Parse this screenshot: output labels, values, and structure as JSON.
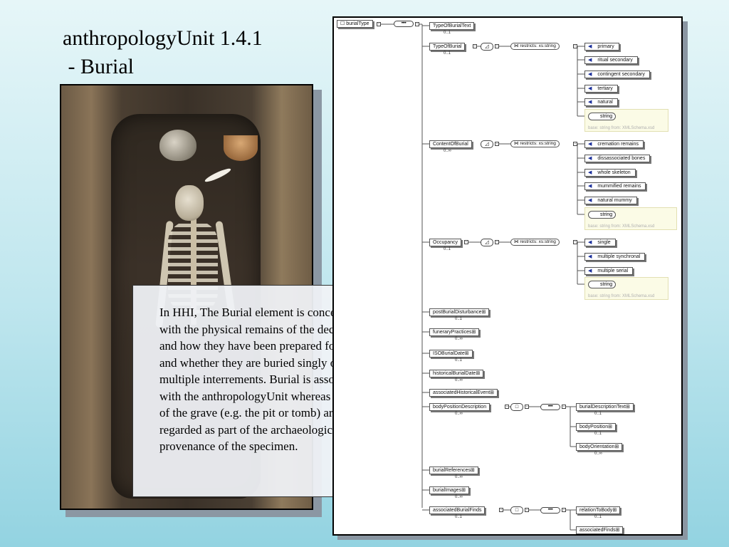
{
  "slide": {
    "title_line1": "anthropologyUnit 1.4.1",
    "title_line2": " - Burial",
    "description": "In HHI, The Burial element is concerned with the physical remains of the deceased and how they have been prepared for burial and whether they are buried singly or in multiple interrements. Burial is associated with the anthropologyUnit whereas details of the grave (e.g. the pit or tomb) are regarded as part of the archaeological provenance of the specimen."
  },
  "schema": {
    "root": "burialType",
    "seq_symbol": "••••",
    "elements": [
      {
        "name": "TypeOfBurialText",
        "occ": "0..1"
      },
      {
        "name": "TypeOfBurial",
        "occ": "0..1",
        "restriction": "restricts: xs:string",
        "enums": [
          "primary",
          "ritual secondary",
          "contingent secondary",
          "tertiary",
          "natural"
        ],
        "base_type": "string",
        "base_label": "base: string from: XMLSchema.xsd"
      },
      {
        "name": "ContentOfBurial",
        "occ": "0..∞",
        "restriction": "restricts: xs:string",
        "enums": [
          "cremation remains",
          "dissassociated bones",
          "whole skeleton",
          "mummified remains",
          "natural mummy"
        ],
        "base_type": "string",
        "base_label": "base: string from: XMLSchema.xsd"
      },
      {
        "name": "Occupancy",
        "occ": "0..1",
        "restriction": "restricts: xs:string",
        "enums": [
          "single",
          "multiple synchronal",
          "multiple serial"
        ],
        "base_type": "string",
        "base_label": "base: string from: XMLSchema.xsd"
      },
      {
        "name": "postBurialDisturbance",
        "occ": "0..1"
      },
      {
        "name": "funeraryPractices",
        "occ": "0..∞"
      },
      {
        "name": "ISOBurialDate",
        "occ": "0..1"
      },
      {
        "name": "historicalBurialDate",
        "occ": "0..∞"
      },
      {
        "name": "associatedHistoricalEvent",
        "occ": ""
      },
      {
        "name": "bodyPositionDescription",
        "occ": "0..∞",
        "children": [
          {
            "name": "burialDescriptionText",
            "occ": "0..1"
          },
          {
            "name": "bodyPosition",
            "occ": "0..1"
          },
          {
            "name": "bodyOrientation",
            "occ": "0..∞"
          }
        ]
      },
      {
        "name": "burialReferences",
        "occ": "0..∞"
      },
      {
        "name": "burialImages",
        "occ": "0..∞"
      },
      {
        "name": "associatedBurialFinds",
        "occ": "0..1",
        "children": [
          {
            "name": "relationToBody",
            "occ": "0..1"
          },
          {
            "name": "associatedFinds",
            "occ": ""
          }
        ]
      }
    ]
  },
  "icons": {
    "photo": "burial-excavation-photo",
    "expand": "expand-plus-icon",
    "enum": "enumeration-triangle-icon",
    "restriction": "restriction-icon"
  },
  "colors": {
    "background_top": "#e6f6f8",
    "background_bottom": "#93d3e1",
    "enum_marker": "#1a2e9a",
    "base_box": "#fbfbe6"
  }
}
